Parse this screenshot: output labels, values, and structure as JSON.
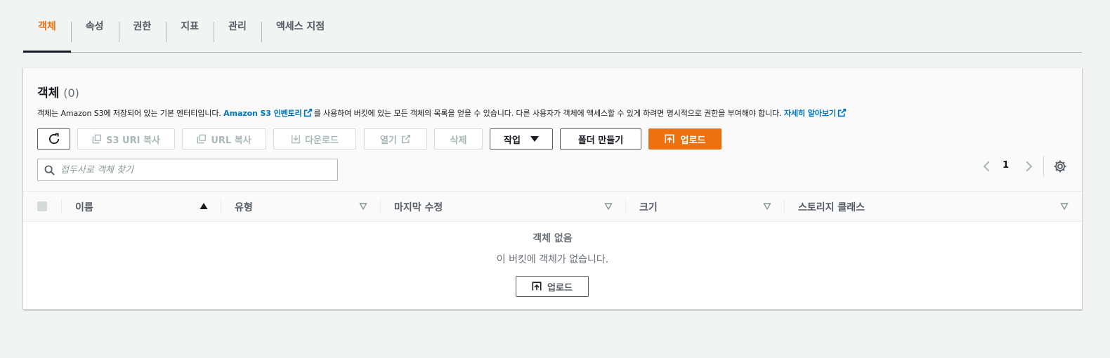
{
  "tabs": [
    {
      "label": "객체",
      "active": true
    },
    {
      "label": "속성",
      "active": false
    },
    {
      "label": "권한",
      "active": false
    },
    {
      "label": "지표",
      "active": false
    },
    {
      "label": "관리",
      "active": false
    },
    {
      "label": "액세스 지점",
      "active": false
    }
  ],
  "panel": {
    "title": "객체",
    "count": "(0)",
    "description": {
      "part1": "객체는 Amazon S3에 저장되어 있는 기본 엔터티입니다. ",
      "link1": "Amazon S3 인벤토리",
      "part2": "를 사용하여 버킷에 있는 모든 객체의 목록을 얻을 수 있습니다. 다른 사용자가 객체에 액세스할 수 있게 하려면 명시적으로 권한을 부여해야 합니다. ",
      "link2": "자세히 알아보기"
    }
  },
  "toolbar": {
    "copy_s3_uri": "S3 URI 복사",
    "copy_url": "URL 복사",
    "download": "다운로드",
    "open": "열기",
    "delete": "삭제",
    "actions": "작업",
    "create_folder": "폴더 만들기",
    "upload": "업로드"
  },
  "search": {
    "placeholder": "접두사로 객체 찾기",
    "value": ""
  },
  "pagination": {
    "current_page": "1"
  },
  "table": {
    "columns": [
      "이름",
      "유형",
      "마지막 수정",
      "크기",
      "스토리지 클래스"
    ],
    "sort_column": "이름",
    "sort_direction": "ascending",
    "rows": []
  },
  "empty_state": {
    "title": "객체 없음",
    "subtitle": "이 버킷에 객체가 없습니다.",
    "upload": "업로드"
  },
  "colors": {
    "accent": "#ec7211",
    "link": "#0073bb",
    "text": "#16191f",
    "muted": "#687078"
  }
}
